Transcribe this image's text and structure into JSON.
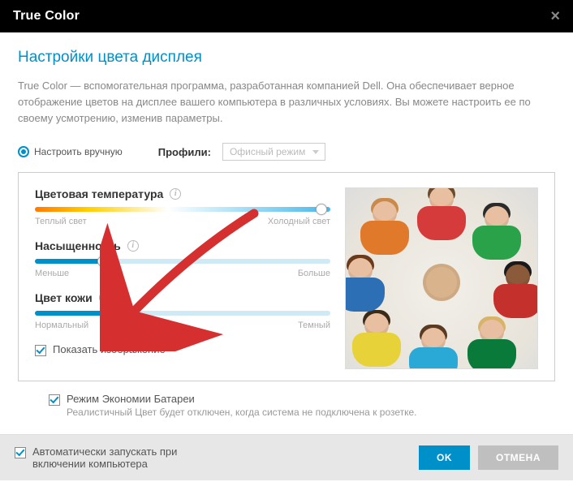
{
  "titlebar": {
    "title": "True Color"
  },
  "heading": "Настройки цвета дисплея",
  "description": "True Color — вспомогательная программа, разработанная компанией Dell. Она обеспечивает верное отображение цветов на дисплее вашего компьютера в различных условиях.  Вы можете настроить ее по своему усмотрению, изменив параметры.",
  "manual_tune_label": "Настроить вручную",
  "profiles_label": "Профили:",
  "profiles_selected": "Офисный режим",
  "sliders": {
    "temperature": {
      "title": "Цветовая температура",
      "left": "Теплый свет",
      "right": "Холодный свет",
      "value_pct": 97
    },
    "saturation": {
      "title": "Насыщенность",
      "left": "Меньше",
      "right": "Больше",
      "value_pct": 23
    },
    "skin": {
      "title": "Цвет кожи",
      "left": "Нормальный",
      "right": "Темный",
      "value_pct": 27
    }
  },
  "show_image_label": "Показать изображение",
  "battery": {
    "title": "Режим Экономии Батареи",
    "sub": "Реалистичный Цвет будет отключен, когда система не подключена к розетке."
  },
  "footer": {
    "autostart": "Автоматически запускать при включении компьютера",
    "ok": "OK",
    "cancel": "ОТМЕНА"
  }
}
